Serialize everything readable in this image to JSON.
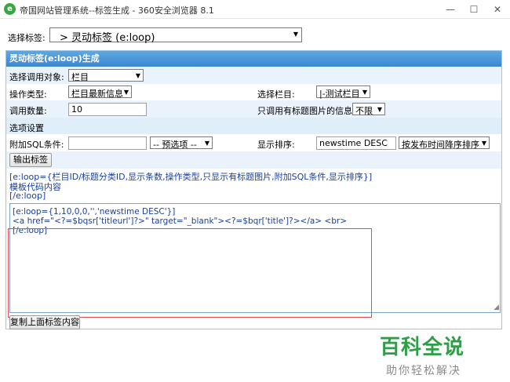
{
  "window": {
    "title": "帝国网站管理系统--标签生成 - 360安全浏览器 8.1",
    "icon": "360-browser-icon",
    "min_glyph": "—",
    "max_glyph": "☐",
    "close_glyph": "✕"
  },
  "tag_select": {
    "label": "选择标签:",
    "value": "> 灵动标签 (e:loop)"
  },
  "panel": {
    "title": "灵动标签(e:loop)生成",
    "call_target": {
      "label": "选择调用对象:",
      "value": "栏目"
    },
    "op_type": {
      "label": "操作类型:",
      "value": "栏目最新信息"
    },
    "column": {
      "label": "选择栏目:",
      "value": "|-测试栏目"
    },
    "count": {
      "label": "调用数量:",
      "value": "10"
    },
    "title_pic": {
      "label": "只调用有标题图片的信息:",
      "value": "不限"
    },
    "section_title": "选项设置",
    "sql": {
      "label": "附加SQL条件:",
      "value": "",
      "preset": "-- 预选项 --"
    },
    "sort": {
      "label": "显示排序:",
      "value": "newstime DESC",
      "preset": "按发布时间降序排序"
    },
    "output_button": "输出标签",
    "syntax": {
      "line1": "[e:loop={栏目ID/标题分类ID,显示条数,操作类型,只显示有标题图片,附加SQL条件,显示排序}]",
      "line2": "模板代码内容",
      "line3": "[/e:loop]"
    },
    "code": {
      "line1": "[e:loop={1,10,0,0,'','newstime DESC'}]",
      "line2": "<a href=\"<?=$bqsr['titleurl']?>\" target=\"_blank\"><?=$bqr['title']?></a> <br>",
      "line3": "[/e:loop]"
    },
    "copy_button": "复制上面标签内容"
  },
  "watermark": {
    "main": "百科全说",
    "sub": "助你轻松解决"
  },
  "colors": {
    "header_blue": "#3c88d0",
    "code_blue": "#1a3f9c",
    "highlight_red": "#e05050",
    "watermark_green": "#2e9e48"
  }
}
